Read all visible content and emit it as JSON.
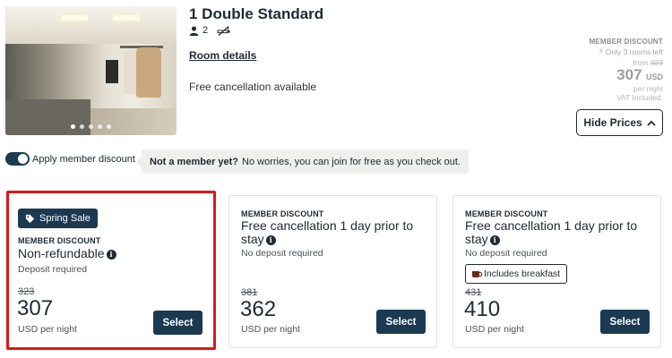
{
  "room": {
    "title": "1 Double Standard",
    "guests": "2",
    "details_link": "Room details",
    "cancellation": "Free cancellation available",
    "photo_count": 5,
    "photo_active": 1
  },
  "price_summary": {
    "member_discount": "MEMBER DISCOUNT",
    "rooms_left": "Only 3 rooms left",
    "from_label": "from",
    "from_price": "323",
    "price": "307",
    "currency": "USD",
    "per_night": "per night",
    "vat": "VAT Included."
  },
  "hide_prices_label": "Hide Prices",
  "member_toggle": {
    "label": "Apply member discount",
    "enabled": true,
    "banner_bold": "Not a member yet?",
    "banner_text": "No worries, you can join for free as you check out."
  },
  "rates": [
    {
      "badge": "Spring Sale",
      "member_label": "MEMBER DISCOUNT",
      "name": "Non-refundable",
      "deposit": "Deposit required",
      "old_price": "323",
      "price": "307",
      "unit": "USD per night",
      "select": "Select",
      "highlighted": true
    },
    {
      "member_label": "MEMBER DISCOUNT",
      "name": "Free cancellation 1 day prior to stay",
      "deposit": "No deposit required",
      "old_price": "381",
      "price": "362",
      "unit": "USD per night",
      "select": "Select"
    },
    {
      "member_label": "MEMBER DISCOUNT",
      "name": "Free cancellation 1 day prior to stay",
      "deposit": "No deposit required",
      "extra": "Includes breakfast",
      "old_price": "431",
      "price": "410",
      "unit": "USD per night",
      "select": "Select"
    }
  ],
  "colors": {
    "primary": "#1b3a52",
    "highlight_border": "#e0161b",
    "text": "#1f2a33"
  }
}
